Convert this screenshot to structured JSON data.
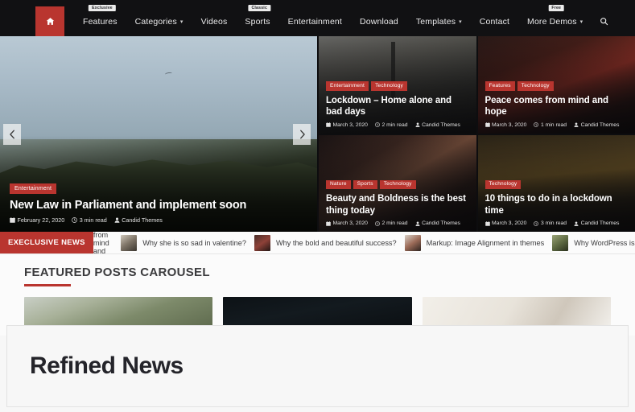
{
  "nav": {
    "home_icon": "home-icon",
    "search_icon": "search-icon",
    "items": [
      {
        "label": "Features",
        "badge": "Exclusive",
        "caret": false
      },
      {
        "label": "Categories",
        "badge": "",
        "caret": true,
        "caret_glyph": "▾"
      },
      {
        "label": "Videos",
        "badge": "",
        "caret": false
      },
      {
        "label": "Sports",
        "badge": "Classic",
        "caret": false
      },
      {
        "label": "Entertainment",
        "badge": "",
        "caret": false
      },
      {
        "label": "Download",
        "badge": "",
        "caret": false
      },
      {
        "label": "Templates",
        "badge": "",
        "caret": true,
        "caret_glyph": "▾"
      },
      {
        "label": "Contact",
        "badge": "",
        "caret": false
      },
      {
        "label": "More Demos",
        "badge": "Free",
        "caret": true,
        "caret_glyph": "▾"
      }
    ]
  },
  "hero": {
    "prev_icon": "chevron-left-icon",
    "next_icon": "chevron-right-icon",
    "main": {
      "categories": [
        "Entertainment"
      ],
      "title": "New Law in Parliament and implement soon",
      "date": "February 22, 2020",
      "read_time": "3 min read",
      "author": "Candid Themes"
    },
    "tiles": [
      {
        "categories": [
          "Entertainment",
          "Technology"
        ],
        "title": "Lockdown – Home alone and bad days",
        "date": "March 3, 2020",
        "read_time": "2 min read",
        "author": "Candid Themes"
      },
      {
        "categories": [
          "Features",
          "Technology"
        ],
        "title": "Peace comes from mind and hope",
        "date": "March 3, 2020",
        "read_time": "1 min read",
        "author": "Candid Themes"
      },
      {
        "categories": [
          "Nature",
          "Sports",
          "Technology"
        ],
        "title": "Beauty and Boldness is the best thing today",
        "date": "March 3, 2020",
        "read_time": "2 min read",
        "author": "Candid Themes"
      },
      {
        "categories": [
          "Technology"
        ],
        "title": "10 things to do in a lockdown time",
        "date": "March 3, 2020",
        "read_time": "3 min read",
        "author": "Candid Themes"
      }
    ]
  },
  "ticker": {
    "label": "EXECLUSIVE NEWS",
    "first_item_text": "nes from mind and hope",
    "items": [
      {
        "text": "Why she is so sad in valentine?"
      },
      {
        "text": "Why the bold and beautiful success?"
      },
      {
        "text": "Markup: Image Alignment in themes"
      },
      {
        "text": "Why WordPress is best C"
      }
    ]
  },
  "featured": {
    "heading": "FEATURED POSTS CAROUSEL"
  },
  "refined": {
    "title": "Refined News"
  },
  "colors": {
    "accent_red": "#b9352f",
    "nav_bg": "#111113",
    "page_bg": "#f7f7f7",
    "panel_bg": "#f7f7f7",
    "text_dark": "#24242a"
  }
}
